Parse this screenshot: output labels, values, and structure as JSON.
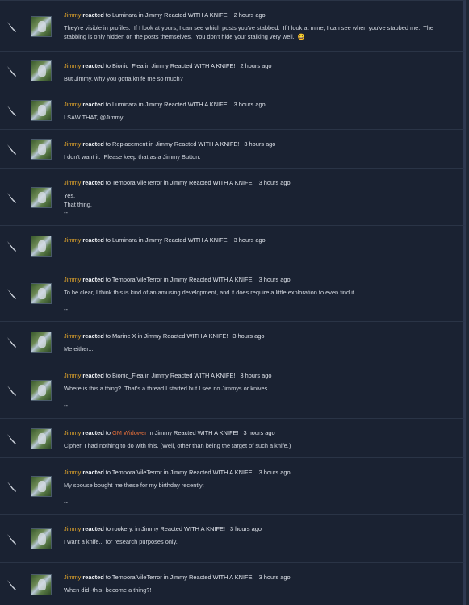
{
  "items": [
    {
      "user": "Jimmy",
      "verb": "reacted",
      "to": "to",
      "target": "Luminara",
      "in": "in",
      "thread": "Jimmy Reacted WITH A KNIFE!",
      "time": "2 hours ago",
      "body": [
        "They're visible in profiles.  If I look at yours, I can see which posts you've stabbed.  If I look at mine, I can see when you've stabbed me.  The stabbing is only hidden on the posts themselves.  You don't hide your stalking very well.  😀"
      ]
    },
    {
      "user": "Jimmy",
      "verb": "reacted",
      "to": "to",
      "target": "Bionic_Flea",
      "in": "in",
      "thread": "Jimmy Reacted WITH A KNIFE!",
      "time": "2 hours ago",
      "body": [
        "But Jimmy, why you gotta knife me so much?"
      ]
    },
    {
      "user": "Jimmy",
      "verb": "reacted",
      "to": "to",
      "target": "Luminara",
      "in": "in",
      "thread": "Jimmy Reacted WITH A KNIFE!",
      "time": "3 hours ago",
      "body": [
        "I SAW THAT, @Jimmy!"
      ]
    },
    {
      "user": "Jimmy",
      "verb": "reacted",
      "to": "to",
      "target": "Replacement",
      "in": "in",
      "thread": "Jimmy Reacted WITH A KNIFE!",
      "time": "3 hours ago",
      "body": [
        "I don't want it.  Please keep that as a Jimmy Button."
      ]
    },
    {
      "user": "Jimmy",
      "verb": "reacted",
      "to": "to",
      "target": "TemporalVileTerror",
      "in": "in",
      "thread": "Jimmy Reacted WITH A KNIFE!",
      "time": "3 hours ago",
      "body": [
        "Yes.",
        "That thing.",
        "--"
      ]
    },
    {
      "user": "Jimmy",
      "verb": "reacted",
      "to": "to",
      "target": "Luminara",
      "in": "in",
      "thread": "Jimmy Reacted WITH A KNIFE!",
      "time": "3 hours ago",
      "body": []
    },
    {
      "user": "Jimmy",
      "verb": "reacted",
      "to": "to",
      "target": "TemporalVileTerror",
      "in": "in",
      "thread": "Jimmy Reacted WITH A KNIFE!",
      "time": "3 hours ago",
      "body": [
        "To be clear, I think this is kind of an amusing development, and it does require a little exploration to even find it.",
        "",
        "--"
      ]
    },
    {
      "user": "Jimmy",
      "verb": "reacted",
      "to": "to",
      "target": "Marine X",
      "in": "in",
      "thread": "Jimmy Reacted WITH A KNIFE!",
      "time": "3 hours ago",
      "body": [
        "Me either...."
      ]
    },
    {
      "user": "Jimmy",
      "verb": "reacted",
      "to": "to",
      "target": "Bionic_Flea",
      "in": "in",
      "thread": "Jimmy Reacted WITH A KNIFE!",
      "time": "3 hours ago",
      "body": [
        "Where is this a thing?  That's a thread I started but I see no Jimmys or knives.",
        "",
        "--"
      ]
    },
    {
      "user": "Jimmy",
      "verb": "reacted",
      "to": "to",
      "target": "GM Widower",
      "in": "in",
      "thread": "Jimmy Reacted WITH A KNIFE!",
      "time": "3 hours ago",
      "body": [
        "Cipher. I had nothing to do with this. (Well, other than being the target of such a knife.)"
      ],
      "target_color": "orange"
    },
    {
      "user": "Jimmy",
      "verb": "reacted",
      "to": "to",
      "target": "TemporalVileTerror",
      "in": "in",
      "thread": "Jimmy Reacted WITH A KNIFE!",
      "time": "3 hours ago",
      "body": [
        "My spouse bought me these for my birthday recently:",
        "",
        "--"
      ]
    },
    {
      "user": "Jimmy",
      "verb": "reacted",
      "to": "to",
      "target": "rookery.",
      "in": "in",
      "thread": "Jimmy Reacted WITH A KNIFE!",
      "time": "3 hours ago",
      "body": [
        "I want a knife... for research purposes only."
      ]
    },
    {
      "user": "Jimmy",
      "verb": "reacted",
      "to": "to",
      "target": "TemporalVileTerror",
      "in": "in",
      "thread": "Jimmy Reacted WITH A KNIFE!",
      "time": "3 hours ago",
      "body": [
        "When did -this- become a thing?!"
      ]
    }
  ]
}
